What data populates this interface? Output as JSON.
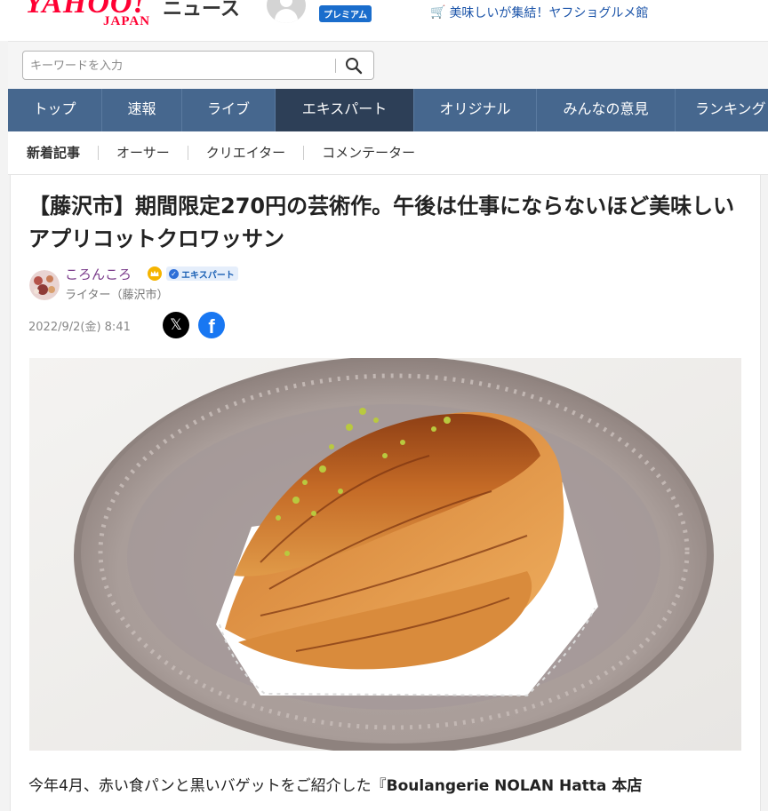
{
  "header": {
    "logo_main": "YAHOO!",
    "logo_sub": "JAPAN",
    "service": "ニュース",
    "premium": "プレミアム",
    "promo": "美味しいが集結！ヤフショグルメ館"
  },
  "search": {
    "placeholder": "キーワードを入力"
  },
  "gnav": {
    "items": [
      {
        "label": "トップ"
      },
      {
        "label": "速報"
      },
      {
        "label": "ライブ"
      },
      {
        "label": "エキスパート",
        "active": true
      },
      {
        "label": "オリジナル"
      },
      {
        "label": "みんなの意見"
      },
      {
        "label": "ランキング"
      }
    ]
  },
  "subnav": {
    "items": [
      {
        "label": "新着記事"
      },
      {
        "label": "オーサー"
      },
      {
        "label": "クリエイター"
      },
      {
        "label": "コメンテーター"
      }
    ]
  },
  "article": {
    "title": "【藤沢市】期間限定270円の芸術作。午後は仕事にならないほど美味しいアプリコットクロワッサン",
    "author": {
      "name": "ころんころ",
      "badge": "エキスパート",
      "role": "ライター（藤沢市）"
    },
    "date": "2022/9/2(金) 8:41",
    "share": {
      "x": "𝕏",
      "facebook": "f"
    },
    "body_prefix": "今年4月、赤い食パンと黒いバゲットをご紹介した『",
    "body_bold": "Boulangerie NOLAN Hatta 本店"
  },
  "colors": {
    "brand": "#ff0033",
    "nav_bg": "#46678e",
    "nav_active": "#2d3f57",
    "author": "#7a3b8a",
    "facebook": "#1877f2"
  }
}
